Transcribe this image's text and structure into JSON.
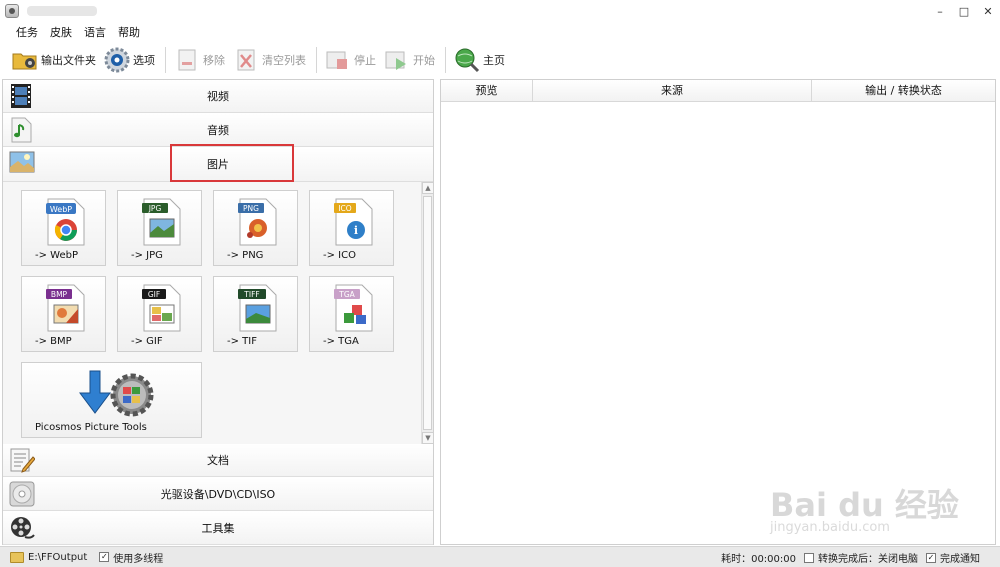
{
  "window": {
    "title": "",
    "controls": {
      "minimize": "–",
      "maximize": "□",
      "close": "✕"
    }
  },
  "menu": [
    "任务",
    "皮肤",
    "语言",
    "帮助"
  ],
  "toolbar": {
    "output_folder": "输出文件夹",
    "options": "选项",
    "remove": "移除",
    "clear_list": "清空列表",
    "stop": "停止",
    "start": "开始",
    "home": "主页"
  },
  "categories": {
    "video": "视频",
    "audio": "音频",
    "image": "图片",
    "document": "文档",
    "rom": "光驱设备\\DVD\\CD\\ISO",
    "tools": "工具集"
  },
  "tiles": [
    {
      "label": "-> WebP",
      "badge": "WebP",
      "color": "#3a78c4"
    },
    {
      "label": "-> JPG",
      "badge": "JPG",
      "color": "#2b5d2b"
    },
    {
      "label": "-> PNG",
      "badge": "PNG",
      "color": "#3a6ea8"
    },
    {
      "label": "-> ICO",
      "badge": "ICO",
      "color": "#e4a81a"
    },
    {
      "label": "-> BMP",
      "badge": "BMP",
      "color": "#7a2f8f"
    },
    {
      "label": "-> GIF",
      "badge": "GIF",
      "color": "#1a1a1a"
    },
    {
      "label": "-> TIF",
      "badge": "TIFF",
      "color": "#214a2a"
    },
    {
      "label": "-> TGA",
      "badge": "TGA",
      "color": "#c8a0c8"
    }
  ],
  "picture_tools": "Picosmos Picture Tools",
  "table": {
    "columns": [
      "预览",
      "来源",
      "输出 / 转换状态"
    ]
  },
  "status": {
    "output_path": "E:\\FFOutput",
    "multithread": "使用多线程",
    "elapsed": "耗时：00:00:00",
    "after_convert": "转换完成后：关闭电脑",
    "notify": "完成通知",
    "check_mark": "✓"
  },
  "watermark": {
    "brand": "Bai du 经验",
    "url": "jingyan.baidu.com"
  }
}
